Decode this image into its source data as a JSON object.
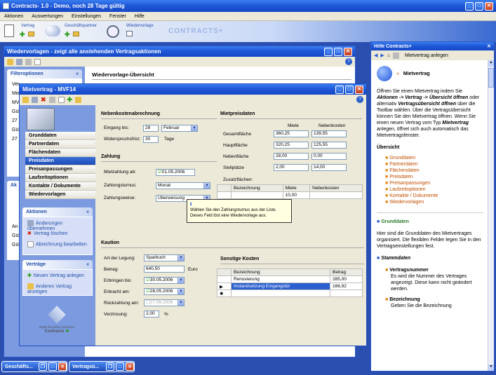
{
  "app": {
    "title": "Contracts- 1.0 - Demo, noch 28 Tage gültig",
    "menu": [
      "Aktionen",
      "Auswertungen",
      "Einstellungen",
      "Fenster",
      "Hilfe"
    ],
    "toolbar": {
      "vertrag": "Vertrag",
      "partner": "Geschäftspartner",
      "wiedervorlage": "Wiedervorlage",
      "brand": "CONTRACTS+"
    }
  },
  "wv_window": {
    "title": "Wiedervorlagen - zeigt alle anstehenden Vertragsaktionen",
    "filter_title": "Filteroptionen",
    "overview": "Wiedervorlage-Übersicht",
    "filter_rows": [
      "Ver",
      "Mie",
      "MV",
      "Gül",
      "27",
      "Gül",
      "27"
    ],
    "ak_title": "Ak",
    "ak_rows": [
      "An",
      "Gül",
      "Gül"
    ]
  },
  "mv_window": {
    "title": "Mietvertrag - MVF14",
    "nav": [
      "Grunddaten",
      "Partnerdaten",
      "Flächendaten",
      "Preisdaten",
      "Preisanpassungen",
      "Laufzeitoptionen",
      "Kontakte / Dokumente",
      "Wiedervorlagen"
    ],
    "nav_selected": 3,
    "aktionen": {
      "title": "Aktionen",
      "items": [
        "Änderungen übernehmen",
        "Vertrag löschen",
        "Abrechnung bearbeiten"
      ]
    },
    "vertrage": {
      "title": "Verträge",
      "items": [
        "Neuen Vertrag anlegen",
        "Anderen Vertrag anzeigen"
      ]
    },
    "logo_text": [
      "Right Business Solutions",
      "Contracts"
    ],
    "nebenkosten": {
      "title": "Nebenkostenabrechnung",
      "eingang_label": "Eingang bis:",
      "eingang_day": "28",
      "eingang_month": "Februar",
      "widerspruch_label": "Widerspruchsfrist:",
      "widerspruch_value": "30",
      "widerspruch_unit": "Tage"
    },
    "zahlung": {
      "title": "Zahlung",
      "ab_label": "Mietzahlung ab:",
      "ab_value": "01.05.2006",
      "turnus_label": "Zahlungsturnus:",
      "turnus_value": "Monat",
      "weise_label": "Zahlungsweise:",
      "weise_value": "Überweisung"
    },
    "tooltip": "Wählen Sie den Zahlungsturnus aus der Liste. Dieses Feld löst eine Wiedervorlage aus.",
    "mietpreis": {
      "title": "Mietpreisdaten",
      "col_miete": "Miete",
      "col_nk": "Nebenkosten",
      "rows": [
        {
          "label": "Gesamtfläche",
          "miete": "360,25",
          "nk": "139,55"
        },
        {
          "label": "Hauptfläche",
          "miete": "320,25",
          "nk": "125,55"
        },
        {
          "label": "Nebenfläche",
          "miete": "28,00",
          "nk": "0,00"
        },
        {
          "label": "Stellplätze",
          "miete": "2,00",
          "nk": "14,00"
        }
      ],
      "zusatz_label": "Zusatzflächen:",
      "zusatz_headers": [
        "Bezeichnung",
        "Miete",
        "Nebenkosten"
      ],
      "zusatz_row": [
        "",
        "10,00",
        ""
      ]
    },
    "kaution": {
      "title": "Kaution",
      "art_label": "Art der Legung:",
      "art_value": "Sparbuch",
      "betrag_label": "Betrag:",
      "betrag_value": "640,50",
      "betrag_unit": "Euro",
      "erbringen_label": "Erbringen bis:",
      "erbringen_value": "30.05.2006",
      "erbracht_label": "Erbracht am:",
      "erbracht_value": "28.05.2006",
      "rueck_label": "Rückzahlung am:",
      "rueck_value": "27.06.2006",
      "zins_label": "Verzinsung:",
      "zins_value": "2,00",
      "zins_unit": "%"
    },
    "sonstige": {
      "title": "Sonstige Kosten",
      "headers": [
        "Bezeichnung",
        "Betrag"
      ],
      "rows": [
        [
          "Renovierung",
          "285,00"
        ],
        [
          "Instandsetzung Eingangstür",
          "166,92"
        ]
      ]
    }
  },
  "help": {
    "title": "Hilfe Contracts+",
    "topic": "Mietvertrag anlegen",
    "heading": "Mietvertrag",
    "intro_parts": [
      "Öffnen Sie einen Mietvertrag indem Sie ",
      "Aktionen -> Vertrag -> Übersicht öffnen",
      " oder alternativ ",
      "Vertragsübersicht öffnen",
      " über die Toolbar wählen. Über die Vertragsübersicht können Sie den Mietvertrag öffnen. Wenn Sie einen neuen Vertrag vom Typ ",
      "Mietvertrag",
      " anlegen, öffnet sich auch automatisch das Mietvertragsfenster."
    ],
    "overview_title": "Übersicht",
    "links": [
      "Grunddaten",
      "Partnerdaten",
      "Flächendaten",
      "Preisdaten",
      "Preisanpassungen",
      "Laufzeitoptionen",
      "Kontakte / Dokumente",
      "Wiedervorlagen"
    ],
    "grund_title": "Grunddaten",
    "grund_text": "Hier sind die Grunddaten des Mietvertrages organisiert. Die flexiblen Felder legen Sie in den Vertragseinstellungen fest.",
    "stamm_title": "Stammdaten",
    "vnr_title": "Vertragsnummer",
    "vnr_text": "Es wird die Nummer des Vertrages angezeigt. Diese kann nicht geändert werden.",
    "bez_title": "Bezeichnung",
    "bez_text": "Geben Sie die Bezeichnung"
  },
  "taskbar": {
    "btn1": "Geschäfts...",
    "btn2": "Vertragsü..."
  },
  "colors": {
    "accent": "#1f58d8",
    "selected": "#2a5fcf",
    "link": "#c04e00"
  }
}
